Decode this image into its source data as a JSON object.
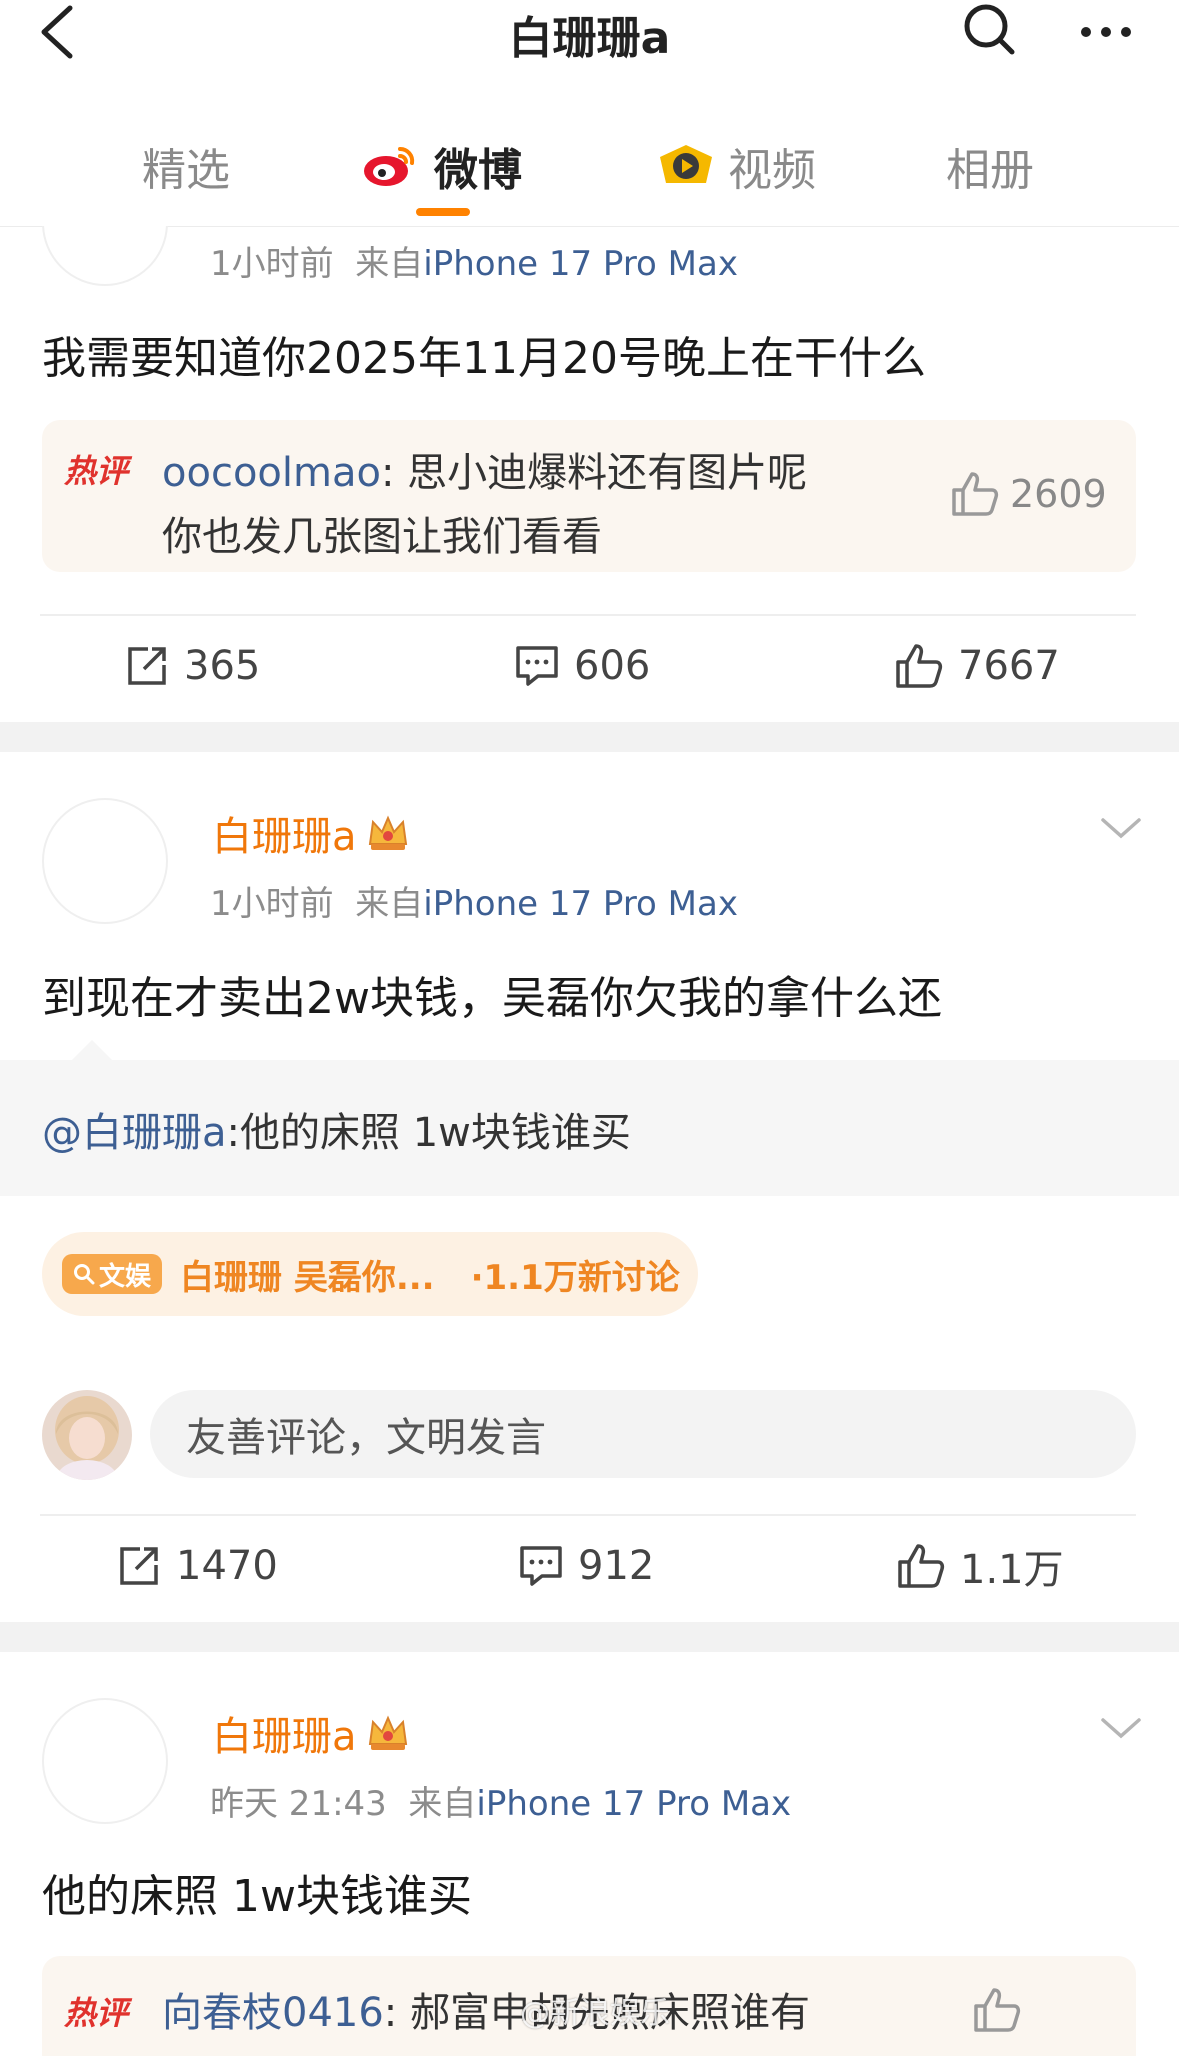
{
  "header": {
    "title": "白珊珊a"
  },
  "tabs": [
    {
      "label": "精选"
    },
    {
      "label": "微博"
    },
    {
      "label": "视频"
    },
    {
      "label": "相册"
    }
  ],
  "colors": {
    "accent": "#ff8200",
    "username": "#f0770a",
    "link": "#3d5f93",
    "hot": "#e0322d"
  },
  "posts": [
    {
      "time": "1小时前",
      "source_prefix": "来自",
      "source": "iPhone 17 Pro Max",
      "text": "我需要知道你2025年11月20号晚上在干什么",
      "hot_comment": {
        "tag": "热评",
        "user": "oocoolmao",
        "line1": "思小迪爆料还有图片呢",
        "line2": "你也发几张图让我们看看",
        "likes": "2609"
      },
      "reposts": "365",
      "comments": "606",
      "likes": "7667"
    },
    {
      "username": "白珊珊a",
      "time": "1小时前",
      "source_prefix": "来自",
      "source": "iPhone 17 Pro Max",
      "text": "到现在才卖出2w块钱，吴磊你欠我的拿什么还",
      "repost": {
        "at_user": "@白珊珊a",
        "text": ":他的床照 1w块钱谁买"
      },
      "topic": {
        "badge": "文娱",
        "text": "白珊珊 吴磊你...",
        "count": "·1.1万新讨论"
      },
      "comment_placeholder": "友善评论，文明发言",
      "reposts": "1470",
      "comments": "912",
      "likes": "1.1万"
    },
    {
      "username": "白珊珊a",
      "time": "昨天 21:43",
      "source_prefix": "来自",
      "source": "iPhone 17 Pro Max",
      "text": "他的床照 1w块钱谁买",
      "hot_comment": {
        "tag": "热评",
        "user": "向春枝0416",
        "line1": "郝富申胡先煦床照谁有"
      }
    }
  ],
  "watermark": "@新浪娱乐"
}
